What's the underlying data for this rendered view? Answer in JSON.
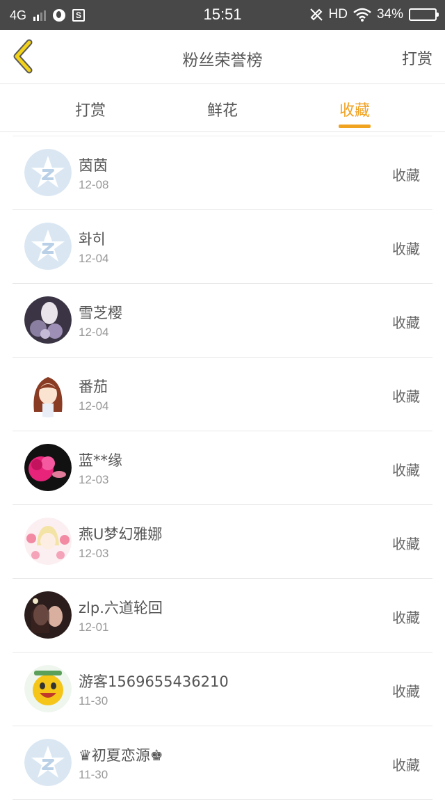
{
  "statusbar": {
    "network": "4G",
    "time": "15:51",
    "hd": "HD",
    "battery": "34%"
  },
  "header": {
    "title": "粉丝荣誉榜",
    "action": "打赏"
  },
  "tabs": [
    {
      "label": "打赏",
      "active": false
    },
    {
      "label": "鲜花",
      "active": false
    },
    {
      "label": "收藏",
      "active": true
    }
  ],
  "colors": {
    "accent": "#f0a221",
    "statusbar_bg": "#484848",
    "default_avatar": "#d9e7f3"
  },
  "list": [
    {
      "name": "茵茵",
      "date": "12-08",
      "action": "收藏",
      "avatar": "default-star"
    },
    {
      "name": "화히",
      "date": "12-04",
      "action": "收藏",
      "avatar": "default-star"
    },
    {
      "name": "雪芝樱",
      "date": "12-04",
      "action": "收藏",
      "avatar": "photo"
    },
    {
      "name": "番茄",
      "date": "12-04",
      "action": "收藏",
      "avatar": "anime-girl"
    },
    {
      "name": "蓝**缘",
      "date": "12-03",
      "action": "收藏",
      "avatar": "pink-flower"
    },
    {
      "name": "燕U梦幻雅娜",
      "date": "12-03",
      "action": "收藏",
      "avatar": "anime-flowers"
    },
    {
      "name": "zlp.六道轮回",
      "date": "12-01",
      "action": "收藏",
      "avatar": "photo-couple"
    },
    {
      "name": "游客1569655436210",
      "date": "11-30",
      "action": "收藏",
      "avatar": "smiley"
    },
    {
      "name": "♛初夏恋源♚",
      "date": "11-30",
      "action": "收藏",
      "avatar": "default-star"
    }
  ]
}
